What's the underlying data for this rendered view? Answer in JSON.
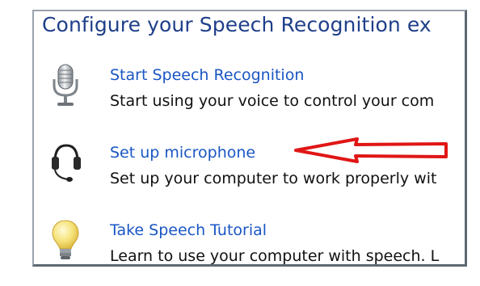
{
  "panel": {
    "heading": "Configure your Speech Recognition ex"
  },
  "items": [
    {
      "link": "Start Speech Recognition",
      "description": "Start using your voice to control your com",
      "icon": "microphone-icon"
    },
    {
      "link": "Set up microphone",
      "description": "Set up your computer to work properly wit",
      "icon": "headset-icon"
    },
    {
      "link": "Take Speech Tutorial",
      "description": "Learn to use your computer with speech.  L",
      "icon": "lightbulb-icon"
    }
  ],
  "annotation": {
    "icon": "red-arrow-annotation",
    "color": "#e01616"
  },
  "colors": {
    "heading": "#1f3f8a",
    "link": "#1a56c4",
    "text": "#111111",
    "border": "#5f6973"
  }
}
